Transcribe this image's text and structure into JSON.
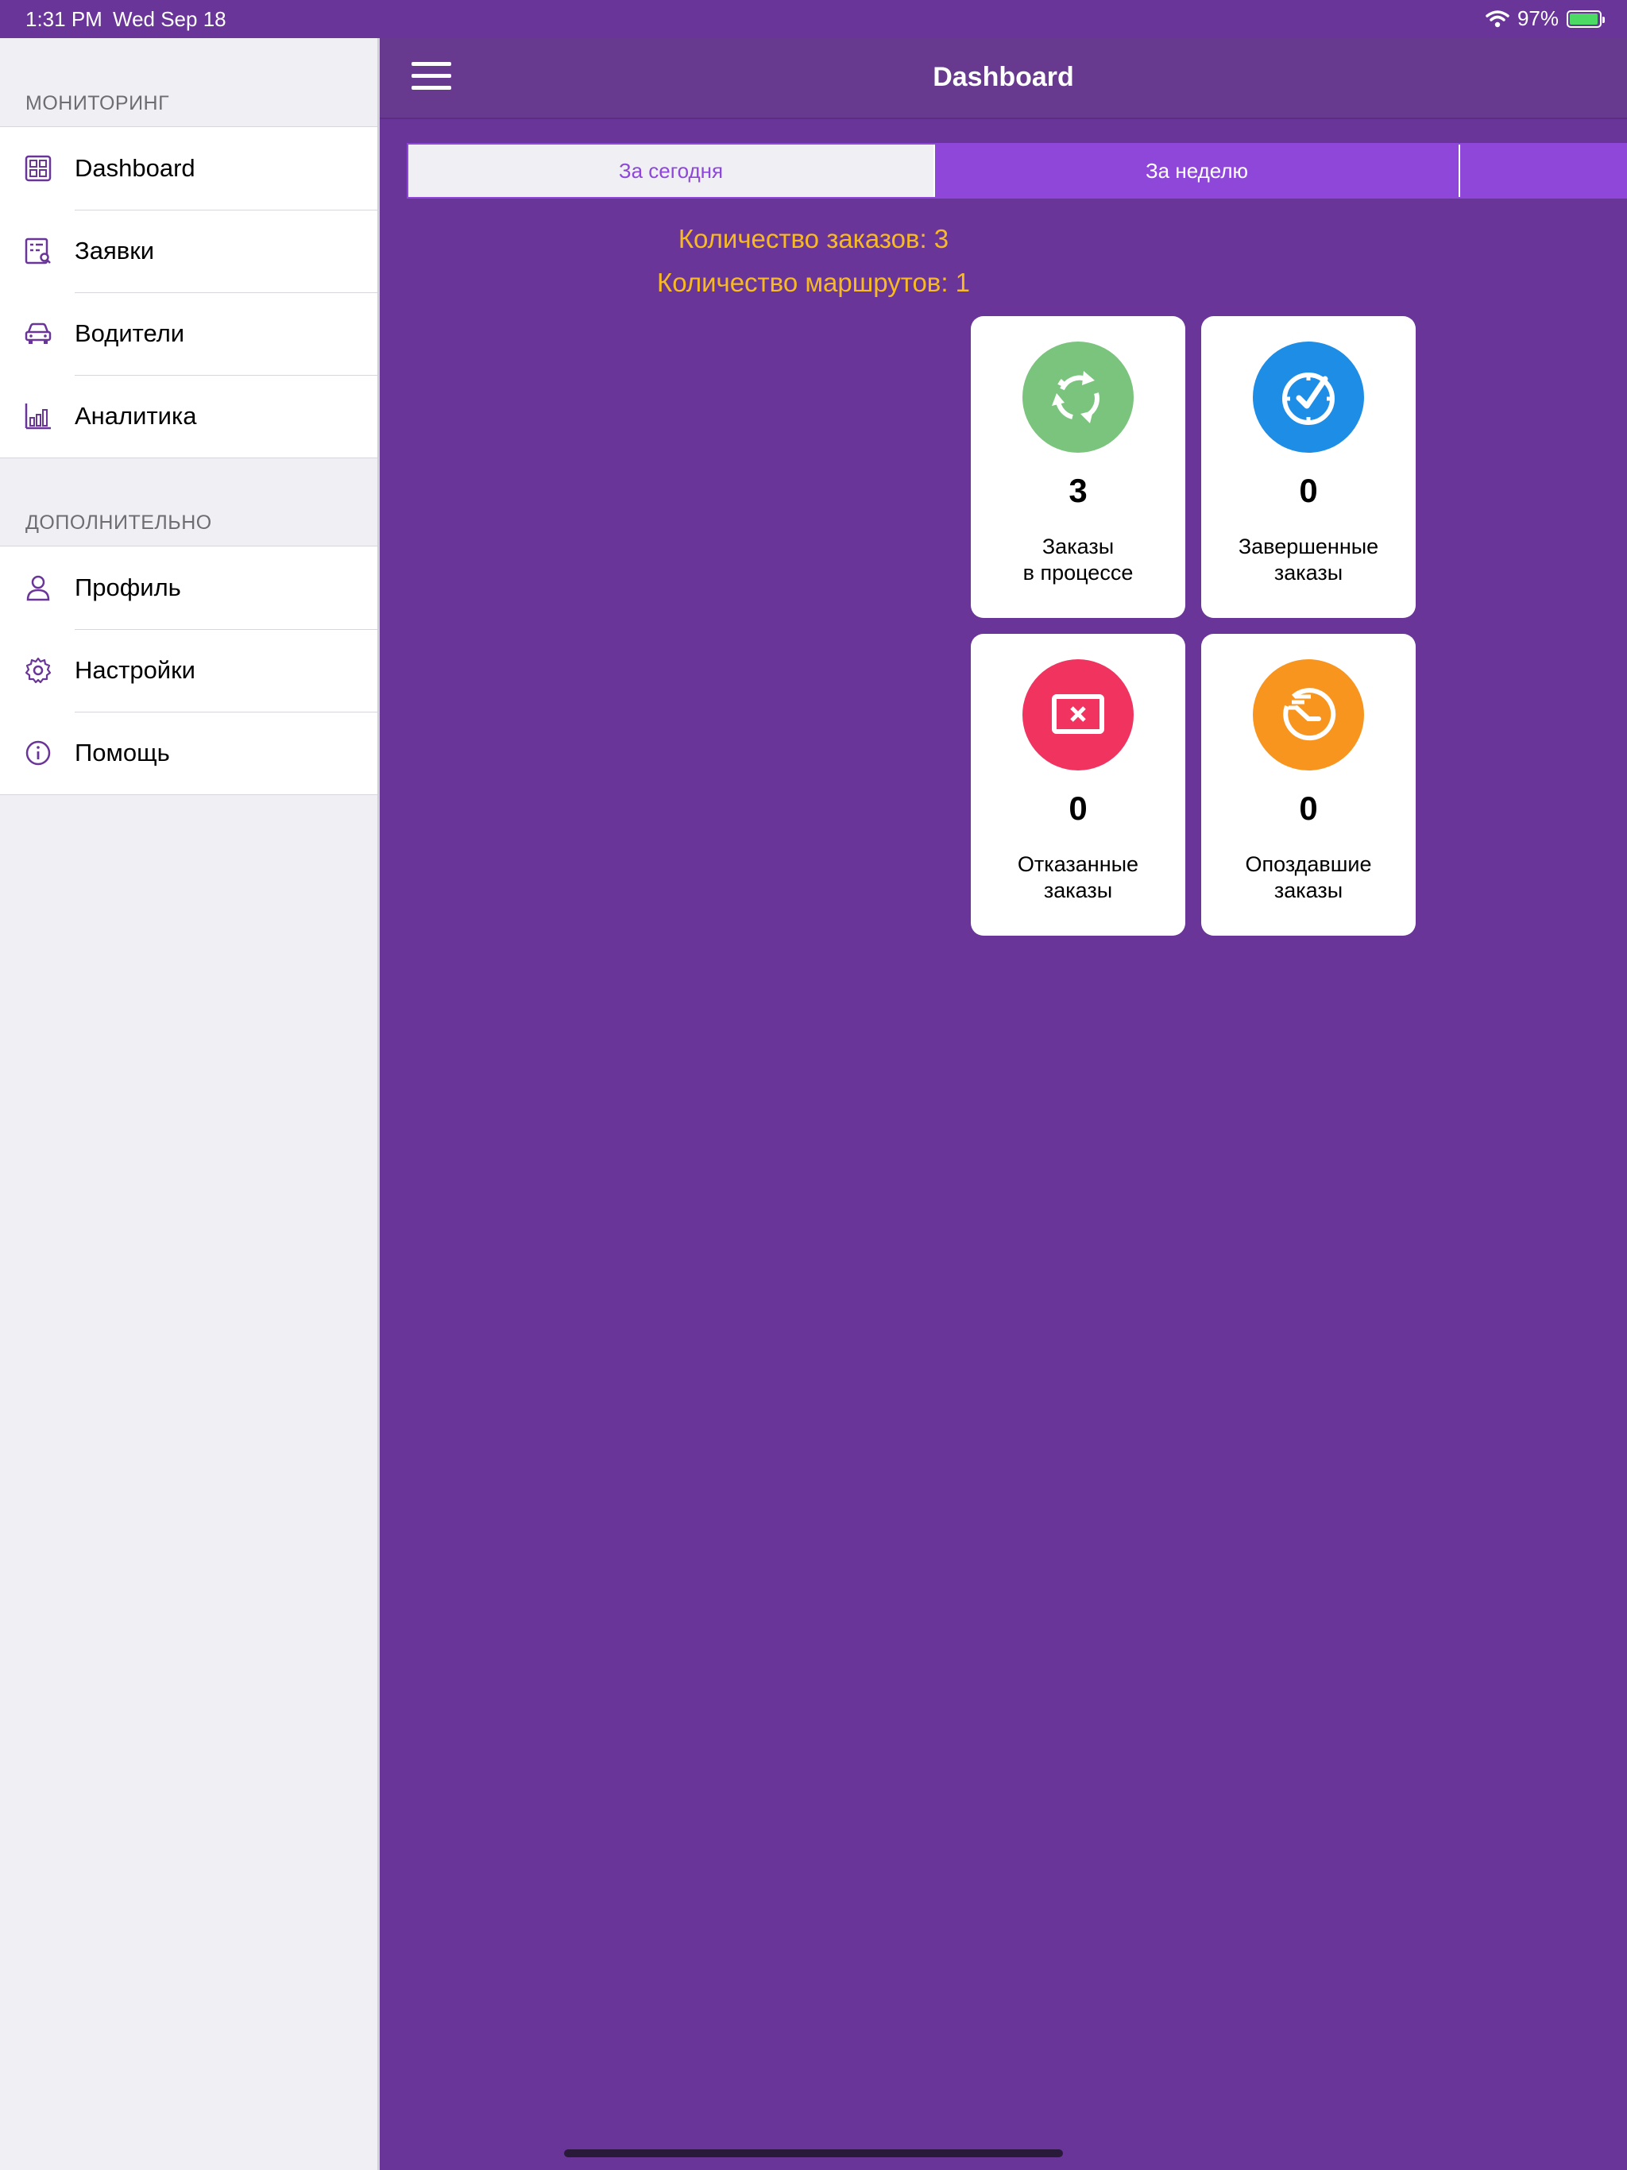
{
  "status_bar": {
    "time": "1:31 PM",
    "date": "Wed Sep 18",
    "battery": "97%",
    "battery_level": 0.97
  },
  "sidebar": {
    "sections": [
      {
        "header": "МОНИТОРИНГ",
        "items": [
          {
            "label": "Dashboard",
            "icon": "dashboard-icon"
          },
          {
            "label": "Заявки",
            "icon": "orders-search-icon"
          },
          {
            "label": "Водители",
            "icon": "car-icon"
          },
          {
            "label": "Аналитика",
            "icon": "bar-chart-icon"
          }
        ]
      },
      {
        "header": "ДОПОЛНИТЕЛЬНО",
        "items": [
          {
            "label": "Профиль",
            "icon": "user-icon"
          },
          {
            "label": "Настройки",
            "icon": "gear-icon"
          },
          {
            "label": "Помощь",
            "icon": "info-icon"
          }
        ]
      }
    ]
  },
  "header": {
    "title": "Dashboard"
  },
  "tabs": [
    {
      "label": "За сегодня",
      "selected": false
    },
    {
      "label": "За неделю",
      "selected": true
    }
  ],
  "summary": {
    "orders_count": "Количество заказов: 3",
    "routes_count": "Количество маршрутов: 1"
  },
  "cards": [
    {
      "value": "3",
      "label": "Заказы\nв процессе",
      "icon": "refresh-icon",
      "color": "#7ac47d"
    },
    {
      "value": "0",
      "label": "Завершенные\nзаказы",
      "icon": "clock-check-icon",
      "color": "#1e8de6"
    },
    {
      "value": "0",
      "label": "Отказанные\nзаказы",
      "icon": "rejected-icon",
      "color": "#f0335f"
    },
    {
      "value": "0",
      "label": "Опоздавшие\nзаказы",
      "icon": "late-clock-icon",
      "color": "#f7951f"
    }
  ],
  "colors": {
    "primary": "#6a3598",
    "accent": "#8e47d9",
    "summary_text": "#f7b924"
  }
}
